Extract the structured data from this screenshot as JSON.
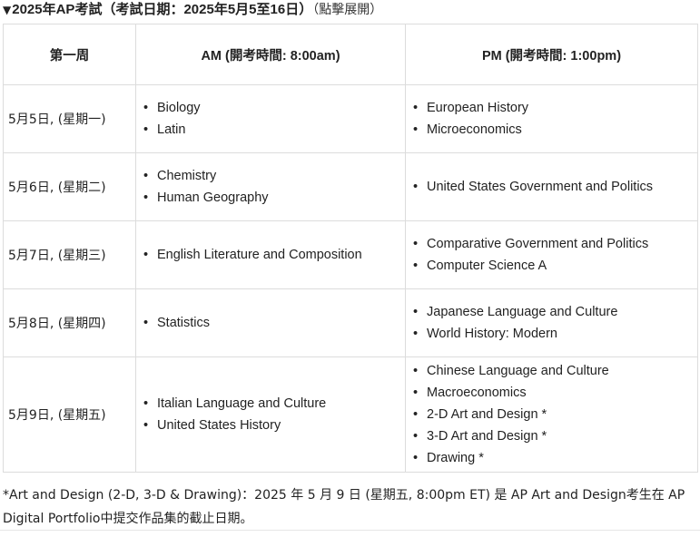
{
  "summary": {
    "arrow": "▼",
    "title": "2025年AP考試",
    "date_range": "（考試日期：2025年5月5至16日）",
    "expand_hint": "（點擊展開）"
  },
  "table": {
    "headers": [
      "第一周",
      "AM (開考時間: 8:00am)",
      "PM (開考時間: 1:00pm)"
    ],
    "rows": [
      {
        "day": "5月5日, (星期一)",
        "am": [
          "Biology",
          "Latin"
        ],
        "pm": [
          "European History",
          "Microeconomics"
        ]
      },
      {
        "day": "5月6日, (星期二)",
        "am": [
          "Chemistry",
          "Human Geography"
        ],
        "pm": [
          "United States Government and Politics"
        ]
      },
      {
        "day": "5月7日, (星期三)",
        "am": [
          "English Literature and Composition"
        ],
        "pm": [
          "Comparative Government and Politics",
          "Computer Science A"
        ]
      },
      {
        "day": "5月8日, (星期四)",
        "am": [
          "Statistics"
        ],
        "pm": [
          "Japanese Language and Culture",
          "World History: Modern"
        ]
      },
      {
        "day": "5月9日, (星期五)",
        "am": [
          "Italian Language and Culture",
          "United States History"
        ],
        "pm": [
          "Chinese Language and Culture",
          "Macroeconomics",
          "2-D Art and Design *",
          "3-D Art and Design *",
          "Drawing *"
        ]
      }
    ]
  },
  "footnote": {
    "text": "*Art and Design (2-D, 3-D & Drawing)：2025 年 5 月 9 日 (星期五, 8:00pm ET) 是 AP Art and Design考生在 AP Digital Portfolio中提交作品集的截止日期。"
  }
}
